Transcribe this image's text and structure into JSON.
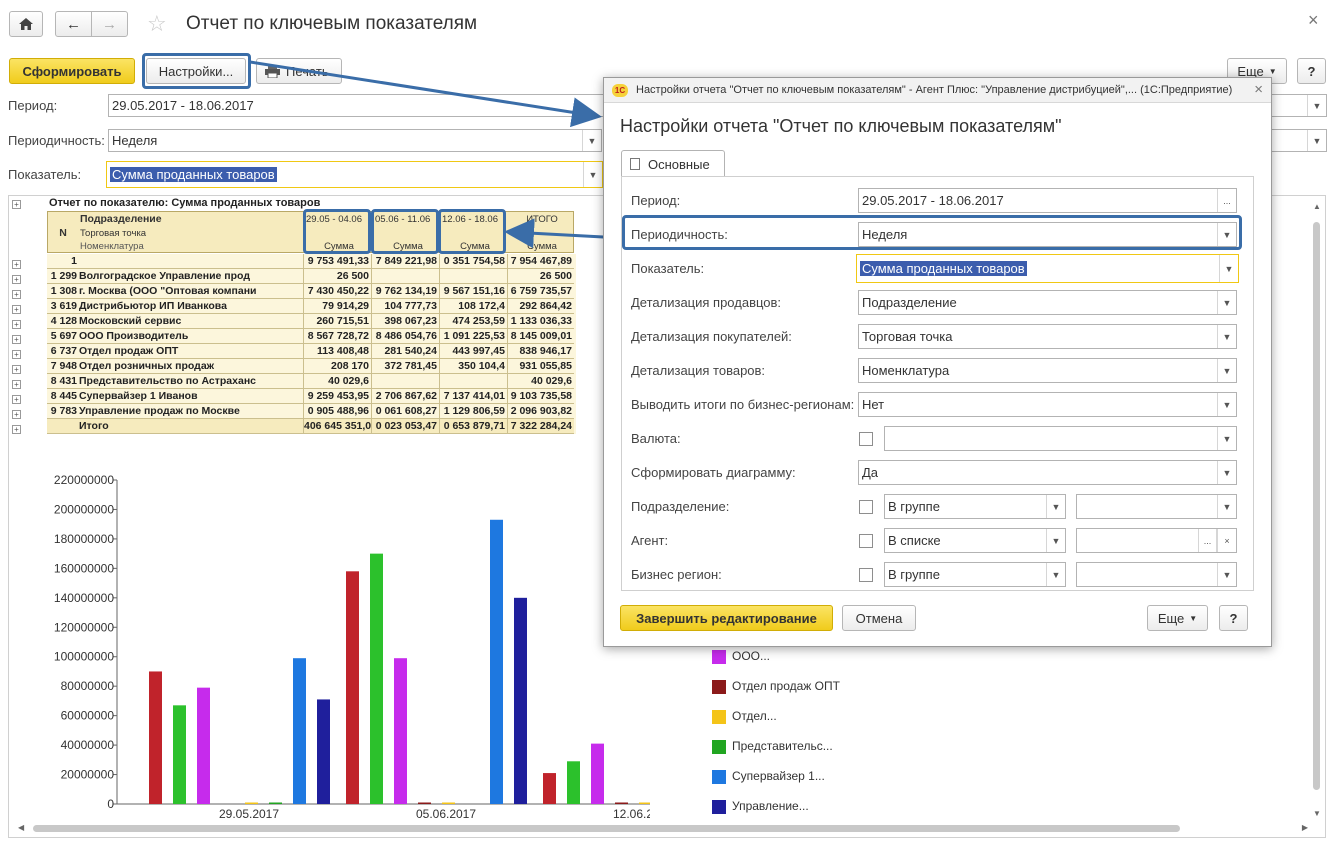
{
  "window": {
    "title": "Отчет по ключевым показателям"
  },
  "toolbar": {
    "generate_label": "Сформировать",
    "settings_label": "Настройки...",
    "print_label": "Печать",
    "more_label": "Еще",
    "help_label": "?"
  },
  "filters": {
    "period_label": "Период:",
    "period_value": "29.05.2017 - 18.06.2017",
    "periodicity_label": "Периодичность:",
    "periodicity_value": "Неделя",
    "indicator_label": "Показатель:",
    "indicator_value": "Сумма проданных товаров"
  },
  "report": {
    "title": "Отчет по показателю: Сумма проданных товаров",
    "header": {
      "n": "N",
      "dept": "Подразделение",
      "point": "Торговая точка",
      "item": "Номенклатура",
      "periods": [
        "29.05 - 04.06",
        "05.06 - 11.06",
        "12.06 - 18.06"
      ],
      "total": "ИТОГО",
      "sum": "Сумма"
    },
    "rows": [
      {
        "n": "1",
        "name": "",
        "v1": "9 753 491,33",
        "v2": "7 849 221,98",
        "v3": "0 351 754,58",
        "total": "7 954 467,89"
      },
      {
        "n": "1 299",
        "name": "Волгоградское  Управление прод",
        "v1": "26 500",
        "v2": "",
        "v3": "",
        "total": "26 500"
      },
      {
        "n": "1 308",
        "name": "г. Москва  (ООО \"Оптовая компани",
        "v1": "7 430 450,22",
        "v2": "9 762 134,19",
        "v3": "9 567 151,16",
        "total": "6 759 735,57"
      },
      {
        "n": "3 619",
        "name": "Дистрибьютор ИП Иванкова",
        "v1": "79 914,29",
        "v2": "104 777,73",
        "v3": "108 172,4",
        "total": "292 864,42"
      },
      {
        "n": "4 128",
        "name": "Московский сервис",
        "v1": "260 715,51",
        "v2": "398 067,23",
        "v3": "474 253,59",
        "total": "1 133 036,33"
      },
      {
        "n": "5 697",
        "name": "ООО Производитель",
        "v1": "8 567 728,72",
        "v2": "8 486 054,76",
        "v3": "1 091 225,53",
        "total": "8 145 009,01"
      },
      {
        "n": "6 737",
        "name": "Отдел продаж ОПТ",
        "v1": "113 408,48",
        "v2": "281 540,24",
        "v3": "443 997,45",
        "total": "838 946,17"
      },
      {
        "n": "7 948",
        "name": "Отдел розничных продаж",
        "v1": "208 170",
        "v2": "372 781,45",
        "v3": "350 104,4",
        "total": "931 055,85"
      },
      {
        "n": "8 431",
        "name": "Представительство по Астраханс",
        "v1": "40 029,6",
        "v2": "",
        "v3": "",
        "total": "40 029,6"
      },
      {
        "n": "8 445",
        "name": "Супервайзер 1 Иванов",
        "v1": "9 259 453,95",
        "v2": "2 706 867,62",
        "v3": "7 137 414,01",
        "total": "9 103 735,58"
      },
      {
        "n": "9 783",
        "name": "Управление продаж по Москве",
        "v1": "0 905 488,96",
        "v2": "0 061 608,27",
        "v3": "1 129 806,59",
        "total": "2 096 903,82"
      }
    ],
    "total_row": {
      "name": "Итого",
      "v1": "406 645 351,06",
      "v2": "0 023 053,47",
      "v3": "0 653 879,71",
      "total": "7 322 284,24"
    }
  },
  "chart_data": {
    "type": "bar",
    "categories": [
      "29.05.2017",
      "05.06.2017",
      "12.06.2017"
    ],
    "ylim": [
      0,
      220000000
    ],
    "yticks": [
      "0",
      "20000000",
      "40000000",
      "60000000",
      "80000000",
      "100000000",
      "120000000",
      "140000000",
      "160000000",
      "180000000",
      "200000000",
      "220000000"
    ],
    "series": [
      {
        "color": "#c0232b",
        "values": [
          90000000,
          158000000,
          21000000
        ]
      },
      {
        "color": "#2cc12c",
        "values": [
          67000000,
          170000000,
          29000000
        ]
      },
      {
        "color": "#c62bec",
        "values": [
          79000000,
          99000000,
          41000000
        ]
      },
      {
        "name": "Отдел продаж ОПТ",
        "color": "#8b1a1a",
        "values": [
          0,
          281540,
          443997
        ]
      },
      {
        "name": "Отдел...",
        "color": "#f4c418",
        "values": [
          208170,
          372781,
          350104
        ]
      },
      {
        "name": "Представительс...",
        "color": "#21a521",
        "values": [
          40029,
          0,
          0
        ]
      },
      {
        "name": "Супервайзер 1...",
        "color": "#1e78e0",
        "values": [
          99000000,
          193000000,
          17000000
        ]
      },
      {
        "name": "Управление...",
        "color": "#1f1f9c",
        "values": [
          71000000,
          140000000,
          21000000
        ]
      }
    ],
    "legend_visible": [
      "ООО...",
      "Отдел продаж ОПТ",
      "Отдел...",
      "Представительс...",
      "Супервайзер 1...",
      "Управление..."
    ],
    "legend_colors": [
      "#c62bec",
      "#8b1a1a",
      "#f4c418",
      "#21a521",
      "#1e78e0",
      "#1f1f9c"
    ]
  },
  "dialog": {
    "window_title": "Настройки отчета \"Отчет по ключевым показателям\" - Агент Плюс: \"Управление дистрибуцией\",...  (1С:Предприятие)",
    "heading": "Настройки отчета \"Отчет по ключевым показателям\"",
    "tab": "Основные",
    "fields": [
      {
        "label": "Период:",
        "value": "29.05.2017 - 18.06.2017"
      },
      {
        "label": "Периодичность:",
        "value": "Неделя"
      },
      {
        "label": "Показатель:",
        "value": "Сумма проданных товаров"
      },
      {
        "label": "Детализация продавцов:",
        "value": "Подразделение"
      },
      {
        "label": "Детализация покупателей:",
        "value": "Торговая точка"
      },
      {
        "label": "Детализация товаров:",
        "value": "Номенклатура"
      },
      {
        "label": "Выводить итоги по бизнес-регионам:",
        "value": "Нет"
      },
      {
        "label": "Валюта:",
        "value": ""
      },
      {
        "label": "Сформировать диаграмму:",
        "value": "Да"
      },
      {
        "label": "Подразделение:",
        "value": "В группе"
      },
      {
        "label": "Агент:",
        "value": "В списке"
      },
      {
        "label": "Бизнес регион:",
        "value": "В группе"
      }
    ],
    "finish_label": "Завершить редактирование",
    "cancel_label": "Отмена",
    "more_label": "Еще",
    "help_label": "?"
  }
}
